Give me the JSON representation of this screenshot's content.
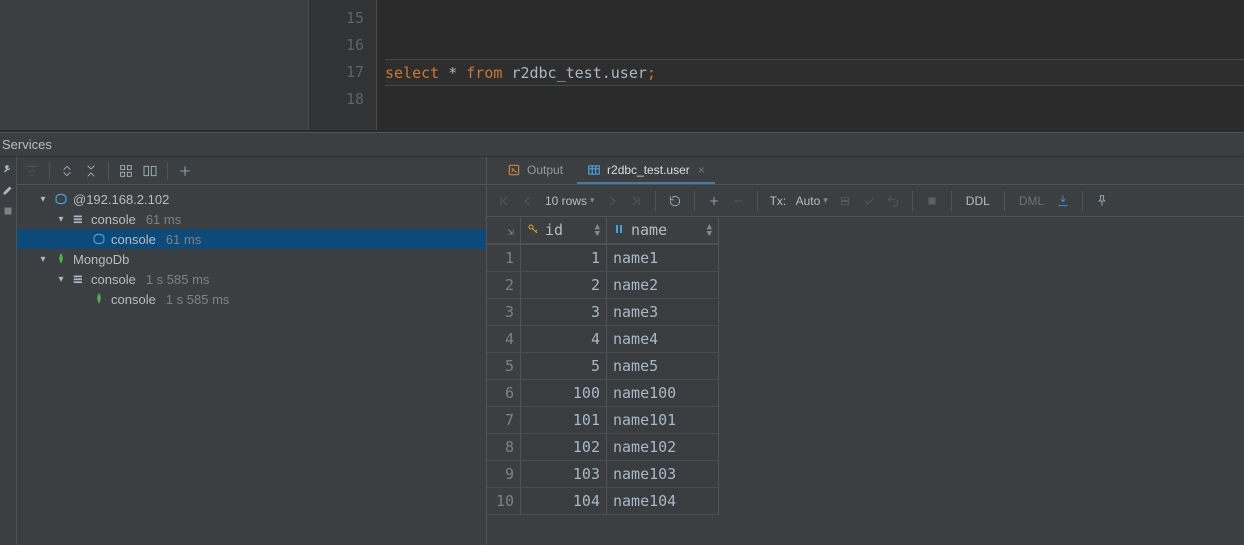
{
  "editor": {
    "lines": [
      "15",
      "16",
      "17",
      "18"
    ],
    "active_index": 2,
    "tokens": {
      "kw1": "select",
      "star": " * ",
      "kw2": "from",
      "sp": " ",
      "ident": "r2dbc_test.user",
      "semi": ";"
    }
  },
  "services": {
    "title": "Services",
    "tree": [
      {
        "level": 1,
        "caret": "▾",
        "icon": "datasource",
        "label": "@192.168.2.102",
        "meta": ""
      },
      {
        "level": 2,
        "caret": "▾",
        "icon": "console-group",
        "label": "console",
        "meta": "61 ms"
      },
      {
        "level": 3,
        "caret": "",
        "icon": "console",
        "label": "console",
        "meta": "61 ms",
        "selected": true
      },
      {
        "level": 1,
        "caret": "▾",
        "icon": "mongo",
        "label": "MongoDb",
        "meta": ""
      },
      {
        "level": 2,
        "caret": "▾",
        "icon": "console-group",
        "label": "console",
        "meta": "1 s 585 ms"
      },
      {
        "level": 3,
        "caret": "",
        "icon": "mongo",
        "label": "console",
        "meta": "1 s 585 ms"
      }
    ]
  },
  "result": {
    "tabs": [
      {
        "icon": "output",
        "label": "Output",
        "active": false,
        "closable": false
      },
      {
        "icon": "table",
        "label": "r2dbc_test.user",
        "active": true,
        "closable": true
      }
    ],
    "toolbar": {
      "page_size": "10 rows",
      "tx_label": "Tx:",
      "tx_mode": "Auto",
      "ddl": "DDL",
      "dml": "DML"
    },
    "columns": [
      {
        "key": "id",
        "label": "id",
        "icon": "key"
      },
      {
        "key": "name",
        "label": "name",
        "icon": "col"
      }
    ],
    "rows": [
      {
        "n": "1",
        "id": "1",
        "name": "name1"
      },
      {
        "n": "2",
        "id": "2",
        "name": "name2"
      },
      {
        "n": "3",
        "id": "3",
        "name": "name3"
      },
      {
        "n": "4",
        "id": "4",
        "name": "name4"
      },
      {
        "n": "5",
        "id": "5",
        "name": "name5"
      },
      {
        "n": "6",
        "id": "100",
        "name": "name100"
      },
      {
        "n": "7",
        "id": "101",
        "name": "name101"
      },
      {
        "n": "8",
        "id": "102",
        "name": "name102"
      },
      {
        "n": "9",
        "id": "103",
        "name": "name103"
      },
      {
        "n": "10",
        "id": "104",
        "name": "name104"
      }
    ]
  }
}
